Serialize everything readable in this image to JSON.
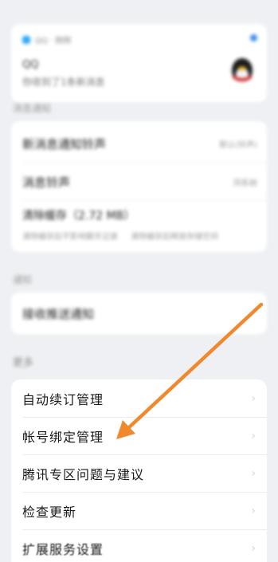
{
  "notification": {
    "app_name": "QQ · 刚刚",
    "title": "QQ",
    "body": "你收到了1条新消息"
  },
  "messages_section": {
    "label": "消息通知",
    "items": [
      {
        "label": "新消息通知铃声",
        "value": "默认(铃声)"
      },
      {
        "label": "消息铃声",
        "value": "同系统"
      },
      {
        "label": "清除缓存（2.72 MB）",
        "sub_left": "清除缓存后不影响聊天记录",
        "sub_right": "清除缓存后释放存储空间"
      }
    ]
  },
  "push_section": {
    "label": "通知",
    "items": [
      {
        "label": "接收推送通知"
      }
    ]
  },
  "more_section": {
    "label": "更多",
    "items": [
      {
        "label": "自动续订管理"
      },
      {
        "label": "帐号绑定管理"
      },
      {
        "label": "腾讯专区问题与建议"
      },
      {
        "label": "检查更新"
      },
      {
        "label": "扩展服务设置"
      }
    ]
  },
  "chevron_glyph": "›",
  "colors": {
    "background": "#eef0f3",
    "card": "#ffffff",
    "annotation_arrow": "#f0892e"
  }
}
